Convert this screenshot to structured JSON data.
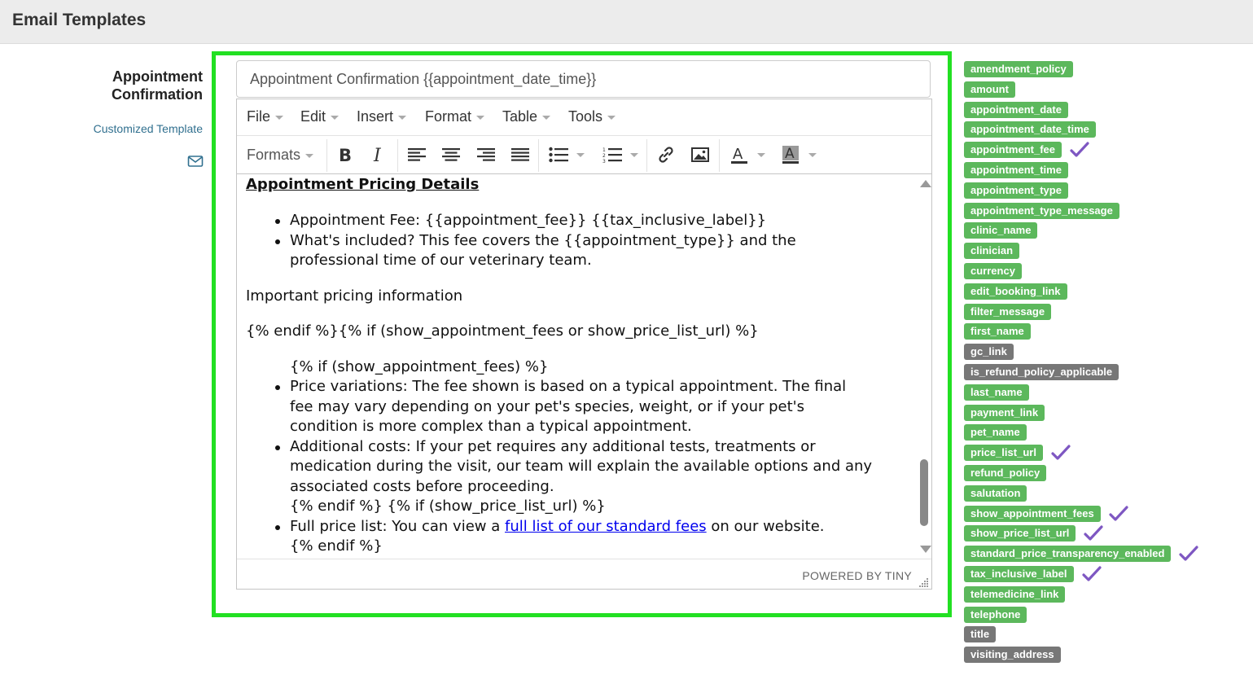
{
  "header": {
    "title": "Email Templates"
  },
  "left": {
    "template_name_line1": "Appointment",
    "template_name_line2": "Confirmation",
    "customized_label": "Customized Template"
  },
  "subject": {
    "value": "Appointment Confirmation {{appointment_date_time}}"
  },
  "menubar": {
    "file": "File",
    "edit": "Edit",
    "insert": "Insert",
    "format": "Format",
    "table": "Table",
    "tools": "Tools"
  },
  "toolbar": {
    "formats": "Formats"
  },
  "content": {
    "heading": "Appointment Pricing Details",
    "fee_line": "Appointment Fee: {{appointment_fee}} {{tax_inclusive_label}}",
    "included_line1": "What's included? This fee covers the {{appointment_type}} and the",
    "included_line2": "professional time of our veterinary team.",
    "important": "Important pricing information",
    "endif_if": "{% endif %}{% if (show_appointment_fees or show_price_list_url) %}",
    "if_fees": "{% if (show_appointment_fees) %}",
    "variation_line1": "Price variations: The fee shown is based on a typical appointment. The final",
    "variation_line2": "fee may vary depending on your pet's species, weight, or if your pet's",
    "variation_line3": "condition is more complex than a typical appointment.",
    "additional_line1": "Additional costs: If your pet requires any additional tests, treatments or",
    "additional_line2": "medication during the visit, our team will explain the available options and any",
    "additional_line3": "associated costs before proceeding.",
    "endif_if_price": "{% endif %} {% if (show_price_list_url) %}",
    "price_list_prefix": "Full price list: You can view a ",
    "price_list_link": "full list of our standard fees",
    "price_list_suffix": " on our website.",
    "endif_last": "{% endif %}"
  },
  "statusbar": {
    "powered": "POWERED BY TINY"
  },
  "tags": [
    {
      "label": "amendment_policy",
      "color": "green",
      "checked": false
    },
    {
      "label": "amount",
      "color": "green",
      "checked": false
    },
    {
      "label": "appointment_date",
      "color": "green",
      "checked": false
    },
    {
      "label": "appointment_date_time",
      "color": "green",
      "checked": false
    },
    {
      "label": "appointment_fee",
      "color": "green",
      "checked": true
    },
    {
      "label": "appointment_time",
      "color": "green",
      "checked": false
    },
    {
      "label": "appointment_type",
      "color": "green",
      "checked": false
    },
    {
      "label": "appointment_type_message",
      "color": "green",
      "checked": false
    },
    {
      "label": "clinic_name",
      "color": "green",
      "checked": false
    },
    {
      "label": "clinician",
      "color": "green",
      "checked": false
    },
    {
      "label": "currency",
      "color": "green",
      "checked": false
    },
    {
      "label": "edit_booking_link",
      "color": "green",
      "checked": false
    },
    {
      "label": "filter_message",
      "color": "green",
      "checked": false
    },
    {
      "label": "first_name",
      "color": "green",
      "checked": false
    },
    {
      "label": "gc_link",
      "color": "gray",
      "checked": false
    },
    {
      "label": "is_refund_policy_applicable",
      "color": "gray",
      "checked": false
    },
    {
      "label": "last_name",
      "color": "green",
      "checked": false
    },
    {
      "label": "payment_link",
      "color": "green",
      "checked": false
    },
    {
      "label": "pet_name",
      "color": "green",
      "checked": false
    },
    {
      "label": "price_list_url",
      "color": "green",
      "checked": true
    },
    {
      "label": "refund_policy",
      "color": "green",
      "checked": false
    },
    {
      "label": "salutation",
      "color": "green",
      "checked": false
    },
    {
      "label": "show_appointment_fees",
      "color": "green",
      "checked": true
    },
    {
      "label": "show_price_list_url",
      "color": "green",
      "checked": true
    },
    {
      "label": "standard_price_transparency_enabled",
      "color": "green",
      "checked": true
    },
    {
      "label": "tax_inclusive_label",
      "color": "green",
      "checked": true
    },
    {
      "label": "telemedicine_link",
      "color": "green",
      "checked": false
    },
    {
      "label": "telephone",
      "color": "green",
      "checked": false
    },
    {
      "label": "title",
      "color": "gray",
      "checked": false
    },
    {
      "label": "visiting_address",
      "color": "gray",
      "checked": false
    }
  ],
  "colors": {
    "frame": "#22e022",
    "tag_green": "#5cb85c",
    "tag_gray": "#777777",
    "check": "#7e57c2"
  }
}
